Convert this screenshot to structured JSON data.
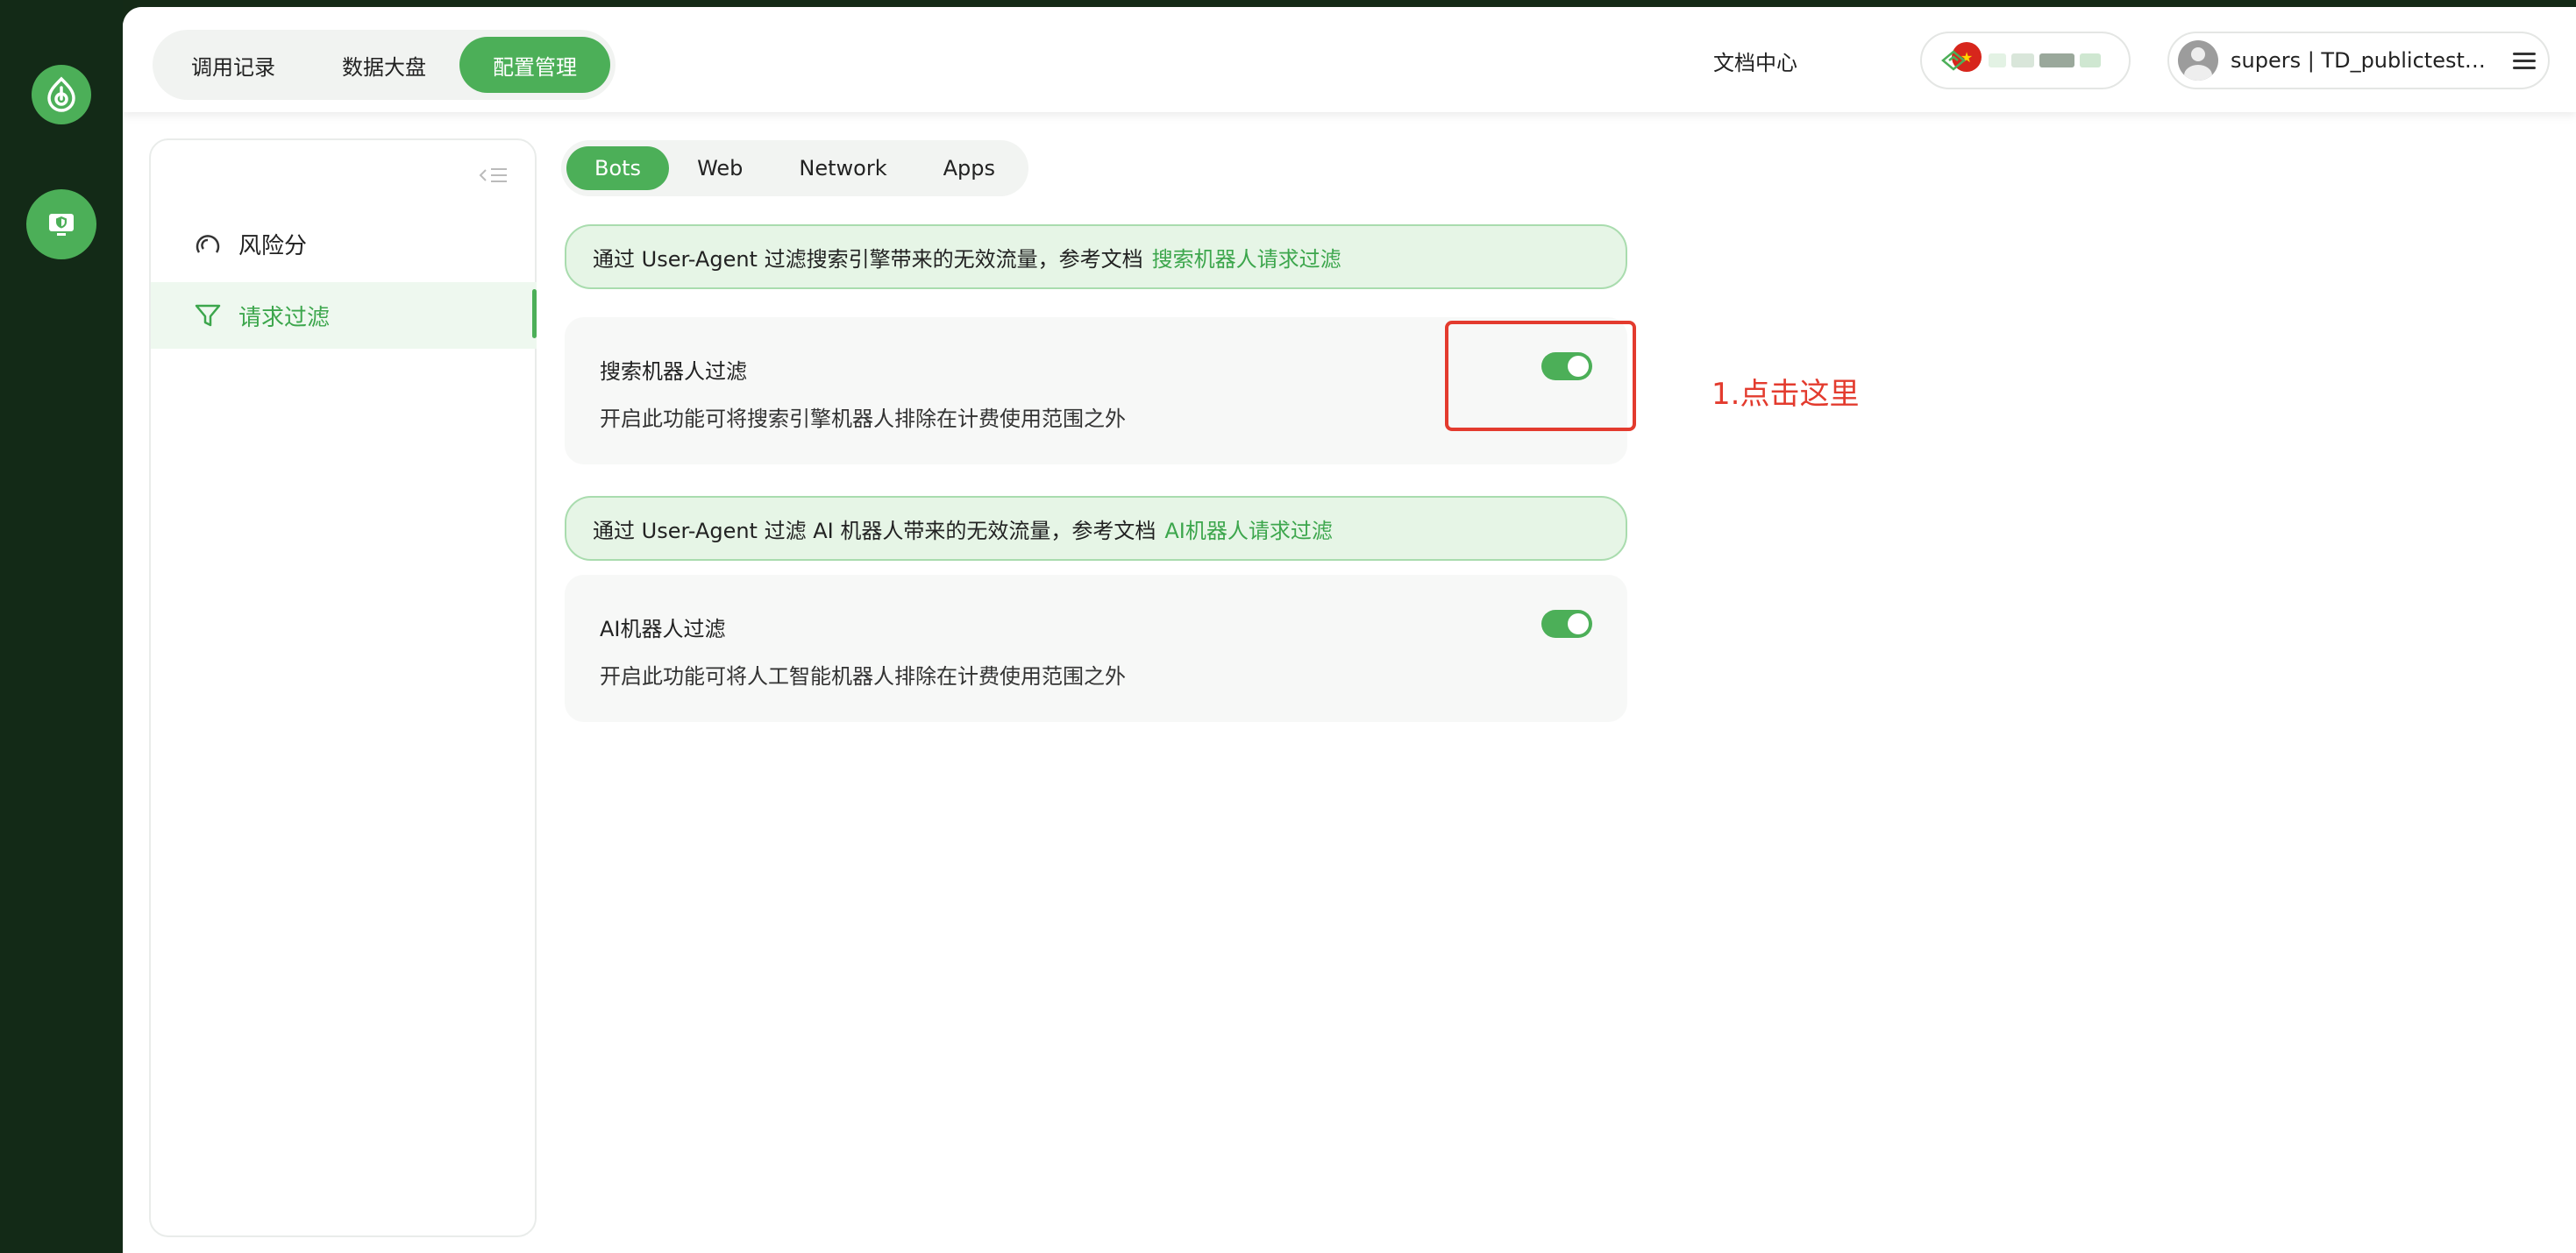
{
  "top_nav": {
    "tabs": [
      {
        "label": "调用记录",
        "active": false
      },
      {
        "label": "数据大盘",
        "active": false
      },
      {
        "label": "配置管理",
        "active": true
      }
    ],
    "doc_center": "文档中心",
    "account_label": "supers | TD_publictest@..."
  },
  "side_menu": {
    "items": [
      {
        "label": "风险分",
        "icon": "gauge-icon",
        "active": false
      },
      {
        "label": "请求过滤",
        "icon": "filter-icon",
        "active": true
      }
    ]
  },
  "sub_tabs": [
    {
      "label": "Bots",
      "active": true
    },
    {
      "label": "Web",
      "active": false
    },
    {
      "label": "Network",
      "active": false
    },
    {
      "label": "Apps",
      "active": false
    }
  ],
  "sections": [
    {
      "banner_text": "通过 User-Agent 过滤搜索引擎带来的无效流量，参考文档",
      "banner_link": "搜索机器人请求过滤",
      "title": "搜索机器人过滤",
      "description": "开启此功能可将搜索引擎机器人排除在计费使用范围之外",
      "enabled": true
    },
    {
      "banner_text": "通过 User-Agent 过滤 AI 机器人带来的无效流量，参考文档",
      "banner_link": "AI机器人请求过滤",
      "title": "AI机器人过滤",
      "description": "开启此功能可将人工智能机器人排除在计费使用范围之外",
      "enabled": true
    }
  ],
  "annotation": "1.点击这里",
  "colors": {
    "accent": "#4caf58",
    "rail": "#132a17",
    "annotation": "#e33b2e",
    "banner_bg": "#e6f5e6"
  }
}
